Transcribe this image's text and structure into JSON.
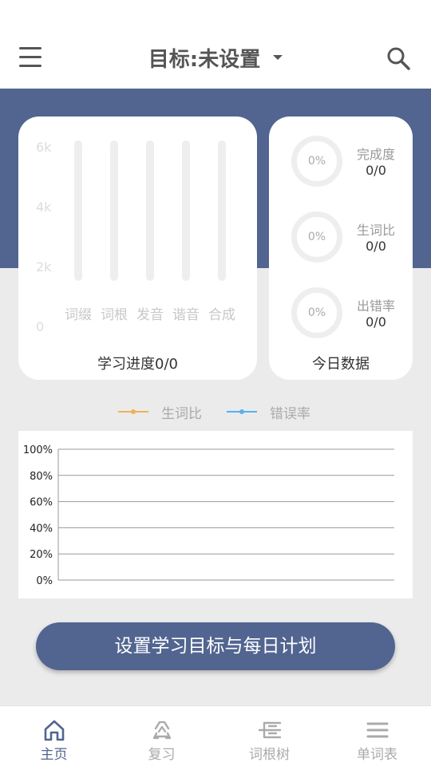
{
  "header": {
    "title": "目标:未设置",
    "menu_icon": "menu-icon",
    "search_icon": "search-icon"
  },
  "progress_card": {
    "y_ticks": [
      "6k",
      "4k",
      "2k",
      "0"
    ],
    "bars": [
      {
        "label": "词缀",
        "value": 0
      },
      {
        "label": "词根",
        "value": 0
      },
      {
        "label": "发音",
        "value": 0
      },
      {
        "label": "谐音",
        "value": 0
      },
      {
        "label": "合成",
        "value": 0
      }
    ],
    "caption": "学习进度0/0"
  },
  "today_card": {
    "stats": [
      {
        "percent": "0%",
        "label": "完成度",
        "value": "0/0"
      },
      {
        "percent": "0%",
        "label": "生词比",
        "value": "0/0"
      },
      {
        "percent": "0%",
        "label": "出错率",
        "value": "0/0"
      }
    ],
    "caption": "今日数据"
  },
  "legend": [
    {
      "label": "生词比",
      "color": "#f0b05a"
    },
    {
      "label": "错误率",
      "color": "#5aaff0"
    }
  ],
  "chart_data": {
    "type": "line",
    "y_ticks": [
      "100%",
      "80%",
      "60%",
      "40%",
      "20%",
      "0%"
    ],
    "ylim": [
      0,
      100
    ],
    "grid": true,
    "legend_placement": "top-center",
    "series": [
      {
        "name": "生词比",
        "values": []
      },
      {
        "name": "错误率",
        "values": []
      }
    ]
  },
  "cta": {
    "label": "设置学习目标与每日计划"
  },
  "tabs": [
    {
      "label": "主页",
      "icon": "home-icon",
      "active": true
    },
    {
      "label": "复习",
      "icon": "recycle-icon",
      "active": false
    },
    {
      "label": "词根树",
      "icon": "tree-icon",
      "active": false
    },
    {
      "label": "单词表",
      "icon": "list-icon",
      "active": false
    }
  ],
  "colors": {
    "primary": "#526590",
    "background": "#ebebeb",
    "series_new_words": "#f0b05a",
    "series_error": "#5aaff0"
  }
}
